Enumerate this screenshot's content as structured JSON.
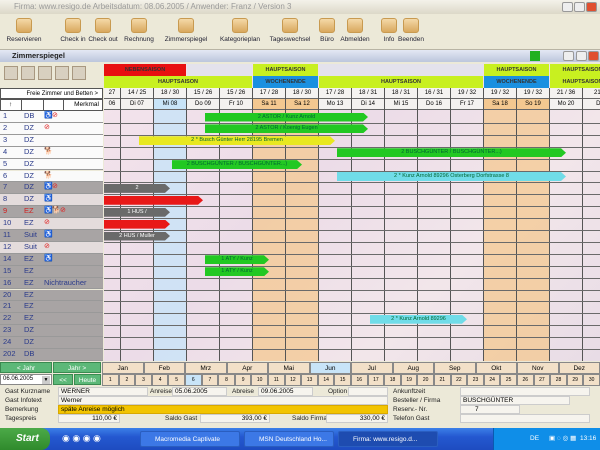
{
  "window": {
    "title": "Firma: www.resigo.de Arbeitsdatum: 08.06.2005 / Anwender: Franz / Version 3"
  },
  "toolbar": [
    {
      "label": "Reservieren",
      "icon": "reserve-icon"
    },
    {
      "label": "Check in",
      "icon": "checkin-icon"
    },
    {
      "label": "Check out",
      "icon": "checkout-icon"
    },
    {
      "label": "Rechnung",
      "icon": "invoice-icon"
    },
    {
      "label": "Zimmerspiegel",
      "icon": "room-chart-icon"
    },
    {
      "label": "Kategorieplan",
      "icon": "category-plan-icon"
    },
    {
      "label": "Tageswechsel",
      "icon": "day-change-icon"
    },
    {
      "label": "Büro",
      "icon": "folder-icon"
    },
    {
      "label": "Abmelden",
      "icon": "logout-icon"
    },
    {
      "label": "Info",
      "icon": "help-icon"
    },
    {
      "label": "Beenden",
      "icon": "exit-icon"
    }
  ],
  "subwindow": {
    "title": "Zimmerspiegel"
  },
  "left_header": {
    "free_label": "Freie Zimmer und Betten >",
    "feature_label": "Merkmal",
    "sort_icon": "arrow-up"
  },
  "seasons_row1": [
    {
      "label": "NEBENSAISON",
      "from": 6,
      "to": 8,
      "color": "#e81010"
    },
    {
      "label": "",
      "from": 9,
      "to": 10,
      "color": "#e4e2ec"
    },
    {
      "label": "HAUPTSAISON",
      "from": 11,
      "to": 12,
      "color": "#c8f020"
    },
    {
      "label": "",
      "from": 13,
      "to": 17,
      "color": "#e4e2ec"
    },
    {
      "label": "HAUPTSAISON",
      "from": 18,
      "to": 19,
      "color": "#c8f020"
    },
    {
      "label": "HAUPTSAISON",
      "from": 20,
      "to": 21,
      "color": "#c8f020"
    }
  ],
  "seasons_row2": [
    {
      "label": "HAUPTSAISON",
      "from": 6,
      "to": 10,
      "color": "#c8f020"
    },
    {
      "label": "WOCHENENDE",
      "from": 11,
      "to": 12,
      "color": "#1a90e0"
    },
    {
      "label": "HAUPTSAISON",
      "from": 13,
      "to": 17,
      "color": "#c8f020"
    },
    {
      "label": "WOCHENENDE",
      "from": 18,
      "to": 19,
      "color": "#1a90e0"
    },
    {
      "label": "HAUPTSAISON",
      "from": 20,
      "to": 21,
      "color": "#c8f020"
    }
  ],
  "days": [
    {
      "day": 6,
      "free": "27",
      "label": "06",
      "type": "normal"
    },
    {
      "day": 7,
      "free": "14 / 25",
      "label": "Di 07",
      "type": "normal"
    },
    {
      "day": 8,
      "free": "18 / 30",
      "label": "Mi 08",
      "type": "today"
    },
    {
      "day": 9,
      "free": "15 / 26",
      "label": "Do 09",
      "type": "normal"
    },
    {
      "day": 10,
      "free": "15 / 26",
      "label": "Fr 10",
      "type": "normal"
    },
    {
      "day": 11,
      "free": "17 / 28",
      "label": "Sa 11",
      "type": "weekend"
    },
    {
      "day": 12,
      "free": "18 / 30",
      "label": "Sa 12",
      "type": "weekend"
    },
    {
      "day": 13,
      "free": "17 / 28",
      "label": "Mo 13",
      "type": "normal"
    },
    {
      "day": 14,
      "free": "18 / 31",
      "label": "Di 14",
      "type": "normal"
    },
    {
      "day": 15,
      "free": "18 / 31",
      "label": "Mi 15",
      "type": "normal"
    },
    {
      "day": 16,
      "free": "16 / 31",
      "label": "Do 16",
      "type": "normal"
    },
    {
      "day": 17,
      "free": "19 / 32",
      "label": "Fr 17",
      "type": "normal"
    },
    {
      "day": 18,
      "free": "19 / 32",
      "label": "Sa 18",
      "type": "weekend"
    },
    {
      "day": 19,
      "free": "19 / 32",
      "label": "So 19",
      "type": "weekend"
    },
    {
      "day": 20,
      "free": "21 / 36",
      "label": "Mo 20",
      "type": "normal"
    },
    {
      "day": 21,
      "free": "21 /",
      "label": "Di",
      "type": "normal"
    }
  ],
  "rooms": [
    {
      "no": "1",
      "cat": "DB",
      "icons": [
        "wheelchair",
        "no-smoking"
      ],
      "shade": "white"
    },
    {
      "no": "2",
      "cat": "DZ",
      "icons": [
        "no-smoking"
      ],
      "shade": "white"
    },
    {
      "no": "3",
      "cat": "DZ",
      "icons": [],
      "shade": "white"
    },
    {
      "no": "4",
      "cat": "DZ",
      "icons": [
        "dog"
      ],
      "shade": "white"
    },
    {
      "no": "5",
      "cat": "DZ",
      "icons": [],
      "shade": "white"
    },
    {
      "no": "6",
      "cat": "DZ",
      "icons": [
        "dog"
      ],
      "shade": "white"
    },
    {
      "no": "7",
      "cat": "DZ",
      "icons": [
        "wheelchair",
        "no-smoking"
      ],
      "shade": "gray"
    },
    {
      "no": "8",
      "cat": "DZ",
      "icons": [
        "wheelchair"
      ],
      "shade": "light"
    },
    {
      "no": "9",
      "cat": "EZ",
      "icons": [
        "wheelchair",
        "dog",
        "no-smoking"
      ],
      "shade": "gray",
      "alert": true
    },
    {
      "no": "10",
      "cat": "EZ",
      "icons": [
        "no-smoking"
      ],
      "shade": "light"
    },
    {
      "no": "11",
      "cat": "Suit",
      "icons": [
        "wheelchair"
      ],
      "shade": "gray"
    },
    {
      "no": "12",
      "cat": "Suit",
      "icons": [
        "no-smoking"
      ],
      "shade": "light"
    },
    {
      "no": "14",
      "cat": "EZ",
      "icons": [
        "wheelchair"
      ],
      "shade": "gray"
    },
    {
      "no": "15",
      "cat": "EZ",
      "icons": [],
      "shade": "gray"
    },
    {
      "no": "16",
      "cat": "EZ",
      "icons": [],
      "feature": "Nichtraucher",
      "shade": "gray"
    },
    {
      "no": "20",
      "cat": "EZ",
      "icons": [],
      "shade": "gray"
    },
    {
      "no": "21",
      "cat": "EZ",
      "icons": [],
      "shade": "gray"
    },
    {
      "no": "22",
      "cat": "EZ",
      "icons": [],
      "shade": "gray"
    },
    {
      "no": "23",
      "cat": "DZ",
      "icons": [],
      "shade": "gray"
    },
    {
      "no": "24",
      "cat": "DZ",
      "icons": [],
      "shade": "gray"
    },
    {
      "no": "202",
      "cat": "DB",
      "icons": [],
      "shade": "gray"
    }
  ],
  "bookings": [
    {
      "room": "1",
      "from": 9,
      "to": 14,
      "label": "2 ASTOR / Kunz Arnold",
      "color": "#22c822"
    },
    {
      "room": "2",
      "from": 9,
      "to": 14,
      "label": "2 ASTOR / Koenig Eugen",
      "color": "#22c822"
    },
    {
      "room": "3",
      "from": 7,
      "to": 13,
      "label": "2 * Busch Günter Herr 28195 Bremen",
      "color": "#e8e820"
    },
    {
      "room": "4",
      "from": 13,
      "to": 20,
      "label": "2 BUSCHGÜNTER / BUSCHGÜNTER...)",
      "color": "#22c822"
    },
    {
      "room": "5",
      "from": 8,
      "to": 12,
      "label": "2 BUSCHGÜNTER / BUSCHGÜNTER...)",
      "color": "#22c822"
    },
    {
      "room": "6",
      "from": 13,
      "to": 20,
      "label": "2 * Kunz Arnold 89296 Osterberg Dorfstrasse 8",
      "color": "#70dce8"
    },
    {
      "room": "7",
      "from": 5,
      "to": 8,
      "label": "2",
      "color": "#6a6a6a"
    },
    {
      "room": "8",
      "from": 5,
      "to": 9,
      "label": "",
      "color": "#e81818"
    },
    {
      "room": "9",
      "from": 5,
      "to": 8,
      "label": "1 HUS /",
      "color": "#6a6a6a"
    },
    {
      "room": "10",
      "from": 5,
      "to": 8,
      "label": "",
      "color": "#e81818"
    },
    {
      "room": "11",
      "from": 5,
      "to": 8,
      "label": "2 HUS / Muller",
      "color": "#6a6a6a"
    },
    {
      "room": "14",
      "from": 9,
      "to": 11,
      "label": "1 ATY / Kunz",
      "color": "#22c822"
    },
    {
      "room": "15",
      "from": 9,
      "to": 11,
      "label": "1 ATY / Kunz",
      "color": "#22c822"
    },
    {
      "room": "22",
      "from": 14,
      "to": 17,
      "label": "2 * Kunz Arnold 89296",
      "color": "#70dce8"
    }
  ],
  "nav": {
    "prev_year": "< Jahr",
    "next_year": "Jahr >",
    "date": "06.06.2005",
    "back": "<<",
    "today": "Heute",
    "months": [
      "Jan",
      "Feb",
      "Mrz",
      "Apr",
      "Mai",
      "Jun",
      "Jul",
      "Aug",
      "Sep",
      "Okt",
      "Nov",
      "Dez"
    ],
    "selected_month": "Jun",
    "days": [
      "1",
      "2",
      "3",
      "4",
      "5",
      "6",
      "7",
      "8",
      "9",
      "10",
      "11",
      "12",
      "13",
      "14",
      "15",
      "16",
      "17",
      "18",
      "19",
      "20",
      "21",
      "22",
      "23",
      "24",
      "25",
      "26",
      "27",
      "28",
      "29",
      "30"
    ],
    "selected_day": "6"
  },
  "guest": {
    "name_label": "Gast Kurzname",
    "name": "WERNER",
    "info_label": "Gast Infotext",
    "info": "Werner",
    "remark_label": "Bemerkung",
    "remark": "späte Anreise möglich",
    "price_label": "Tagespreis",
    "price": "110,00 €",
    "arrival_label": "Anreise",
    "arrival": "05.06.2005",
    "departure_label": "Abreise",
    "departure": "09.06.2005",
    "option_label": "Option",
    "saldo_guest_label": "Saldo Gast",
    "saldo_guest": "393,00 €",
    "saldo_company_label": "Saldo Firma",
    "saldo_company": "330,00 €",
    "arrival_time_label": "Ankunftzeit",
    "company_label": "Besteller / Firma",
    "company": "BUSCHGÜNTER",
    "res_label": "Reserv.- Nr.",
    "res_no": "7",
    "phone_label": "Telefon Gast"
  },
  "taskbar": {
    "start": "Start",
    "tasks": [
      "Macromedia Captivate",
      "MSN Deutschland Ho...",
      "Firma: www.resigo.d..."
    ],
    "lang": "DE",
    "clock": "13:16"
  },
  "colors": {
    "accent": "#22c822",
    "weekend": "#f4c890",
    "today": "#c8e4f8"
  }
}
